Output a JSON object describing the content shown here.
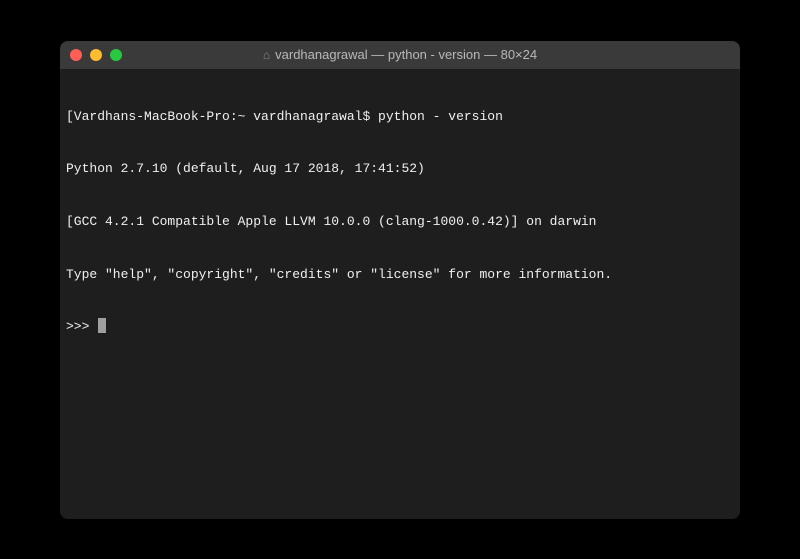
{
  "window": {
    "title": "vardhanagrawal — python - version — 80×24",
    "home_icon": "⌂"
  },
  "terminal": {
    "lines": [
      "[Vardhans-MacBook-Pro:~ vardhanagrawal$ python - version",
      "Python 2.7.10 (default, Aug 17 2018, 17:41:52)",
      "[GCC 4.2.1 Compatible Apple LLVM 10.0.0 (clang-1000.0.42)] on darwin",
      "Type \"help\", \"copyright\", \"credits\" or \"license\" for more information."
    ],
    "prompt": ">>> "
  }
}
